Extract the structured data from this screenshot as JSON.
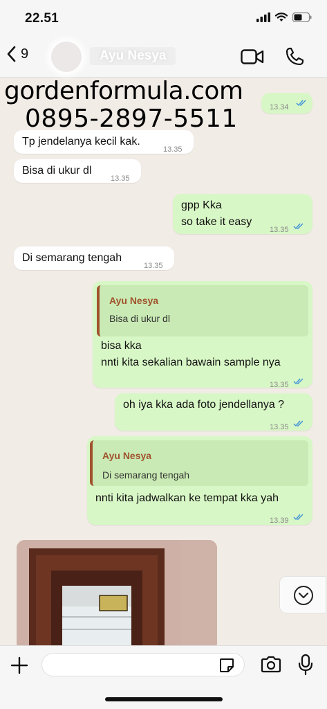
{
  "status_bar": {
    "time": "22.51"
  },
  "header": {
    "back_count": "9",
    "contact_name": "Ayu Nesya"
  },
  "watermark": {
    "site": "gordenformula.com",
    "phone": "0895-2897-5511"
  },
  "messages": [
    {
      "dir": "out",
      "text": "",
      "time": "13.34",
      "status": "read"
    },
    {
      "dir": "in",
      "text": "Tp jendelanya kecil kak.",
      "time": "13.35"
    },
    {
      "dir": "in",
      "text": "Bisa di ukur dl",
      "time": "13.35"
    },
    {
      "dir": "out",
      "lines": [
        "gpp Kka",
        "so take it easy"
      ],
      "time": "13.35",
      "status": "read"
    },
    {
      "dir": "in",
      "text": "Di semarang tengah",
      "time": "13.35"
    },
    {
      "dir": "out",
      "quote_name": "Ayu Nesya",
      "quote_text": "Bisa di ukur dl",
      "lines": [
        "bisa kka",
        "nnti kita sekalian bawain sample nya"
      ],
      "time": "13.35",
      "status": "read"
    },
    {
      "dir": "out",
      "text": "oh iya kka ada foto jendellanya ?",
      "time": "13.35",
      "status": "read"
    },
    {
      "dir": "out",
      "quote_name": "Ayu Nesya",
      "quote_text": "Di semarang tengah",
      "text": "nnti kita jadwalkan ke tempat kka yah",
      "time": "13.39",
      "status": "read"
    },
    {
      "dir": "in",
      "type": "image"
    }
  ],
  "colors": {
    "outgoing_bubble": "#d8f7c6",
    "incoming_bubble": "#ffffff",
    "read_tick": "#3b8fd9",
    "quote_accent": "#a0522d"
  },
  "icons": [
    "back-chevron-icon",
    "video-call-icon",
    "phone-icon",
    "plus-icon",
    "sticker-icon",
    "camera-icon",
    "microphone-icon",
    "chevron-down-icon"
  ]
}
